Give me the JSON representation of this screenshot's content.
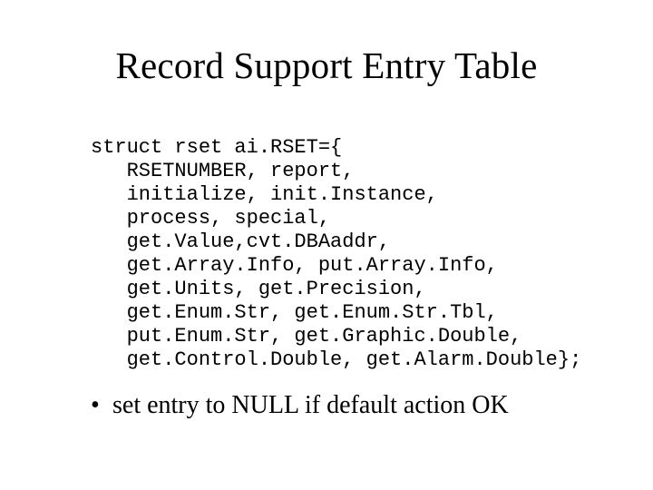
{
  "title": "Record Support Entry Table",
  "code": {
    "line1": "struct rset ai.RSET={",
    "line2": "   RSETNUMBER, report,",
    "line3": "   initialize, init.Instance,",
    "line4": "   process, special,",
    "line5": "   get.Value,cvt.DBAaddr,",
    "line6": "   get.Array.Info, put.Array.Info,",
    "line7": "   get.Units, get.Precision,",
    "line8": "   get.Enum.Str, get.Enum.Str.Tbl,",
    "line9": "   put.Enum.Str, get.Graphic.Double,",
    "line10": "   get.Control.Double, get.Alarm.Double};"
  },
  "bullet": {
    "marker": "•",
    "text": "set entry to NULL if default action OK"
  }
}
